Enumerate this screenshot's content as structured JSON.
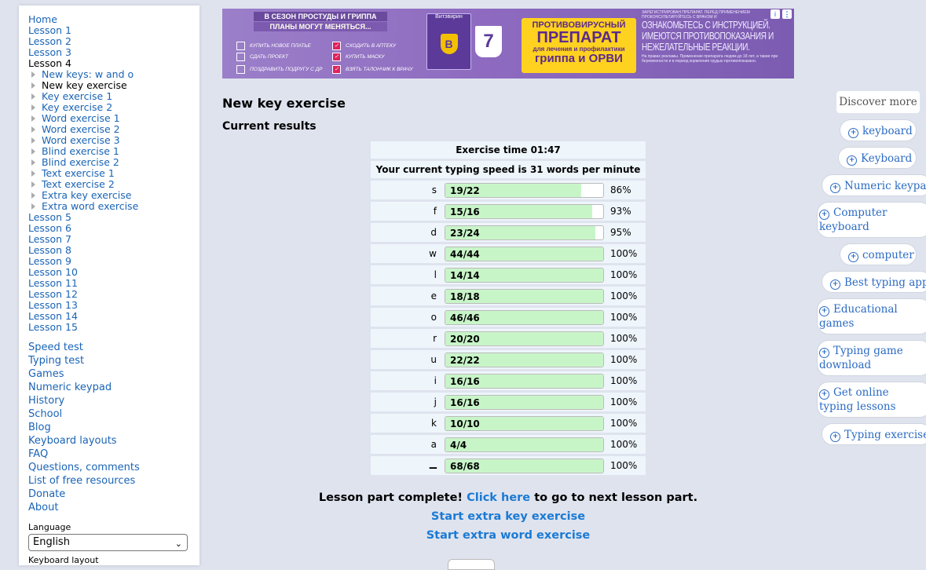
{
  "sidebar": {
    "nav": [
      "Home",
      "Lesson 1",
      "Lesson 2",
      "Lesson 3"
    ],
    "current_lesson": "Lesson 4",
    "sub": [
      {
        "label": "New keys: w and o",
        "current": false
      },
      {
        "label": "New key exercise",
        "current": true
      },
      {
        "label": "Key exercise 1",
        "current": false
      },
      {
        "label": "Key exercise 2",
        "current": false
      },
      {
        "label": "Word exercise 1",
        "current": false
      },
      {
        "label": "Word exercise 2",
        "current": false
      },
      {
        "label": "Word exercise 3",
        "current": false
      },
      {
        "label": "Blind exercise 1",
        "current": false
      },
      {
        "label": "Blind exercise 2",
        "current": false
      },
      {
        "label": "Text exercise 1",
        "current": false
      },
      {
        "label": "Text exercise 2",
        "current": false
      },
      {
        "label": "Extra key exercise",
        "current": false
      },
      {
        "label": "Extra word exercise",
        "current": false
      }
    ],
    "nav_more": [
      "Lesson 5",
      "Lesson 6",
      "Lesson 7",
      "Lesson 8",
      "Lesson 9",
      "Lesson 10",
      "Lesson 11",
      "Lesson 12",
      "Lesson 13",
      "Lesson 14",
      "Lesson 15"
    ],
    "links": [
      "Speed test",
      "Typing test",
      "Games",
      "Numeric keypad",
      "History",
      "School",
      "Blog",
      "Keyboard layouts",
      "FAQ",
      "Questions, comments",
      "List of free resources",
      "Donate",
      "About"
    ],
    "language_label": "Language",
    "language_value": "English",
    "keyboard_label": "Keyboard layout"
  },
  "ad": {
    "headline1": "В СЕЗОН ПРОСТУДЫ И ГРИППА",
    "headline2": "ПЛАНЫ МОГУТ МЕНЯТЬСЯ...",
    "left_items": [
      "КУПИТЬ НОВОЕ ПЛАТЬЕ",
      "СДАТЬ ПРОЕКТ",
      "ПОЗДРАВИТЬ ПОДРУГУ С ДР"
    ],
    "right_items": [
      "СХОДИТЬ В АПТЕКУ",
      "КУПИТЬ МАСКУ",
      "ВЗЯТЬ ТАЛОНЧИК К ВРАЧУ"
    ],
    "product": "Витэвирин",
    "cup_number": "7",
    "promo_line1": "ПРОТИВОВИРУСНЫЙ",
    "promo_line2": "ПРЕПАРАТ",
    "promo_line3": "для лечения и профилактики",
    "promo_line4": "гриппа и ОРВИ",
    "warning_top": "ЗАРЕГИСТРИРОВАН ПРЕПАРАТ. ПЕРЕД ПРИМЕНЕНИЕМ ПРОКОНСУЛЬТИРУЙТЕСЬ С ВРАЧОМ И",
    "warning_main": "ОЗНАКОМЬТЕСЬ С ИНСТРУКЦИЕЙ. ИМЕЮТСЯ ПРОТИВОПОКАЗАНИЯ И НЕЖЕЛАТЕЛЬНЫЕ РЕАКЦИИ.",
    "warning_bottom": "На правах рекламы. Применение препарата людям до 18 лет, а также при беременности и в период кормления грудью противопоказано.",
    "info_icon": "i",
    "menu_icon": "⋮"
  },
  "main": {
    "title": "New key exercise",
    "subtitle": "Current results",
    "exercise_time": "Exercise time 01:47",
    "speed": "Your current typing speed is 31 words per minute",
    "keys": [
      {
        "key": "s",
        "count": "19/22",
        "pct": "86%",
        "fill": 0.86
      },
      {
        "key": "f",
        "count": "15/16",
        "pct": "93%",
        "fill": 0.93
      },
      {
        "key": "d",
        "count": "23/24",
        "pct": "95%",
        "fill": 0.95
      },
      {
        "key": "w",
        "count": "44/44",
        "pct": "100%",
        "fill": 1
      },
      {
        "key": "l",
        "count": "14/14",
        "pct": "100%",
        "fill": 1
      },
      {
        "key": "e",
        "count": "18/18",
        "pct": "100%",
        "fill": 1
      },
      {
        "key": "o",
        "count": "46/46",
        "pct": "100%",
        "fill": 1
      },
      {
        "key": "r",
        "count": "20/20",
        "pct": "100%",
        "fill": 1
      },
      {
        "key": "u",
        "count": "22/22",
        "pct": "100%",
        "fill": 1
      },
      {
        "key": "i",
        "count": "16/16",
        "pct": "100%",
        "fill": 1
      },
      {
        "key": "j",
        "count": "16/16",
        "pct": "100%",
        "fill": 1
      },
      {
        "key": "k",
        "count": "10/10",
        "pct": "100%",
        "fill": 1
      },
      {
        "key": "a",
        "count": "4/4",
        "pct": "100%",
        "fill": 1
      },
      {
        "key": "▁",
        "count": "68/68",
        "pct": "100%",
        "fill": 1
      }
    ],
    "complete_prefix": "Lesson part complete!",
    "complete_link": "Click here",
    "complete_suffix": "to go to next lesson part.",
    "extra_key": "Start extra key exercise",
    "extra_word": "Start extra word exercise"
  },
  "discover": {
    "title": "Discover more",
    "icon": "+",
    "items": [
      "keyboard",
      "Keyboard",
      "Numeric keypad",
      "Computer keyboard",
      "computer",
      "Best typing apps",
      "Educational games",
      "Typing game download",
      "Get online typing lessons",
      "Typing exercises"
    ]
  }
}
